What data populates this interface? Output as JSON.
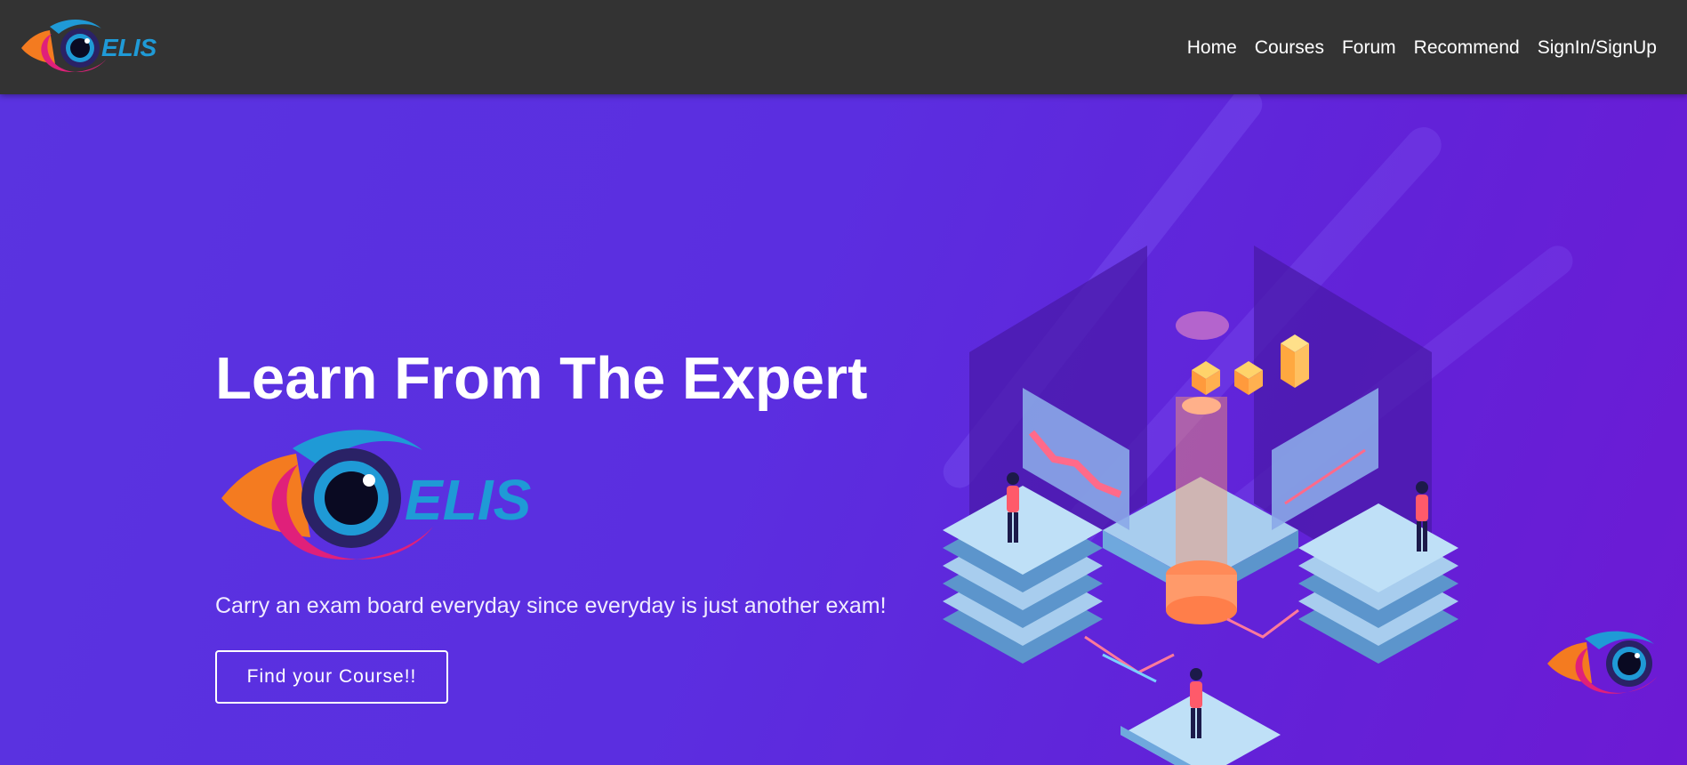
{
  "brand": {
    "logo_text": "ELIS",
    "logo_icon": "eye-logo-icon"
  },
  "nav": {
    "items": [
      {
        "label": "Home"
      },
      {
        "label": "Courses"
      },
      {
        "label": "Forum"
      },
      {
        "label": "Recommend"
      },
      {
        "label": "SignIn/SignUp"
      }
    ]
  },
  "hero": {
    "title": "Learn From The Expert",
    "logo_text": "ELIS",
    "tagline": "Carry an exam board everyday since everyday is just another exam!",
    "cta_label": "Find your Course!!",
    "illustration": "isometric-data-servers-illustration"
  },
  "colors": {
    "navbar": "#333333",
    "hero_gradient_start": "#5a33e0",
    "hero_gradient_end": "#6d1ad4",
    "logo_blue": "#1f9ad6",
    "logo_orange": "#f47b20",
    "logo_pink": "#e0207a",
    "text": "#ffffff"
  }
}
